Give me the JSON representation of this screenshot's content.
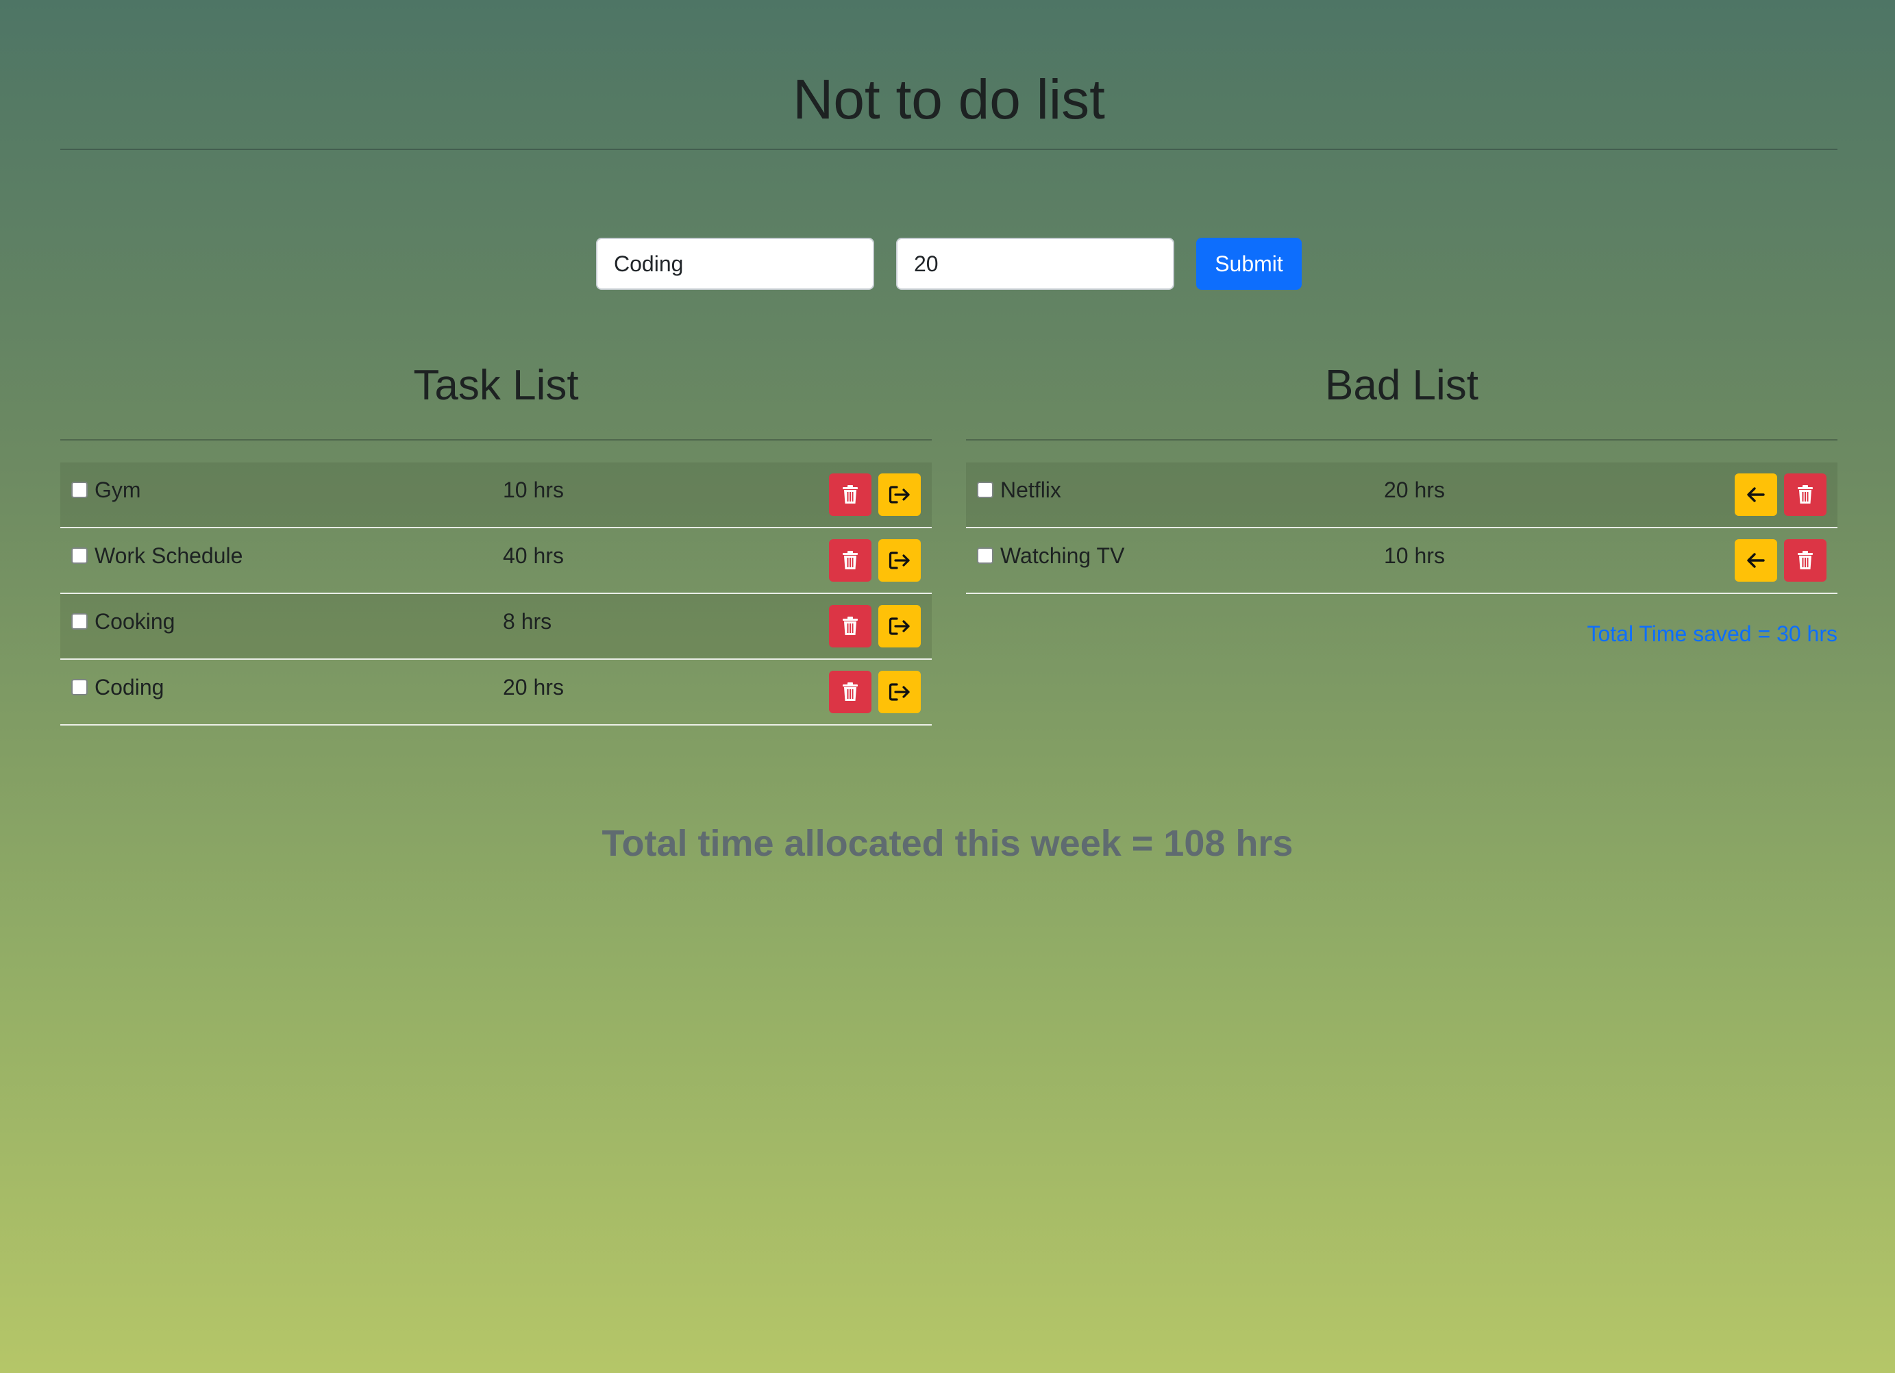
{
  "app": {
    "title": "Not to do list"
  },
  "form": {
    "task_value": "Coding",
    "hours_value": "20",
    "submit_label": "Submit"
  },
  "task_list": {
    "heading": "Task List",
    "rows": [
      {
        "name": "Gym",
        "hours": "10 hrs"
      },
      {
        "name": "Work Schedule",
        "hours": "40 hrs"
      },
      {
        "name": "Cooking",
        "hours": "8 hrs"
      },
      {
        "name": "Coding",
        "hours": "20 hrs"
      }
    ]
  },
  "bad_list": {
    "heading": "Bad List",
    "rows": [
      {
        "name": "Netflix",
        "hours": "20 hrs"
      },
      {
        "name": "Watching TV",
        "hours": "10 hrs"
      }
    ],
    "saved_text": "Total Time saved = 30 hrs"
  },
  "totals": {
    "allocated_text": "Total time allocated this week = 108 hrs"
  },
  "colors": {
    "danger": "#dc3545",
    "warning": "#ffc107",
    "primary": "#0d6efd"
  },
  "icons": {
    "delete": "trash-icon",
    "move_to_bad": "exit-arrow-icon",
    "move_back": "arrow-left-icon"
  }
}
